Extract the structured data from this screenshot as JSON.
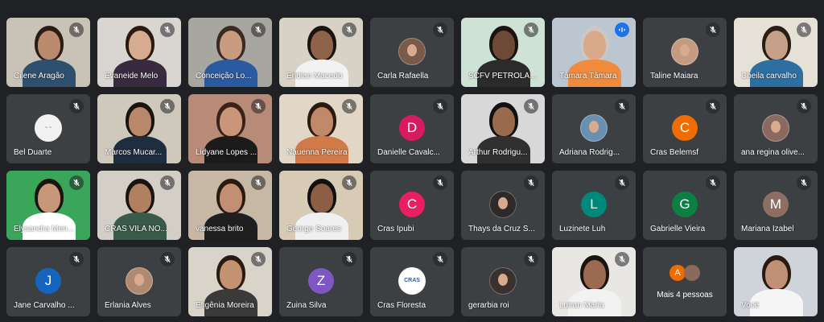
{
  "colors": {
    "background": "#202124",
    "tile": "#3c4043",
    "speaking_outline": "#8ab4f8"
  },
  "participants": [
    {
      "name": "Cilene Aragão",
      "type": "video",
      "bg": "#c9c2b6",
      "skin": "#b98a6d",
      "shirt": "#2f4f6f",
      "hair": "#2b1d16"
    },
    {
      "name": "Evaneide Melo",
      "type": "video",
      "bg": "#d9d6d1",
      "skin": "#d6ab8f",
      "shirt": "#3a2a40",
      "hair": "#2a1a12"
    },
    {
      "name": "Conceição Lo...",
      "type": "video",
      "bg": "#a8a6a0",
      "skin": "#c99b80",
      "shirt": "#2a5aa0",
      "hair": "#3a2a20"
    },
    {
      "name": "Eridian Macedo",
      "type": "video",
      "bg": "#d8d2c6",
      "skin": "#8f624a",
      "shirt": "#f2f2f2",
      "hair": "#1a1410"
    },
    {
      "name": "Carla Rafaella",
      "type": "avatar-photo",
      "color": "#7a5a48"
    },
    {
      "name": "SCFV PETROLA...",
      "type": "video",
      "bg": "#cfe2d6",
      "skin": "#6e4a36",
      "shirt": "#2b2b2b",
      "hair": "#1a1410"
    },
    {
      "name": "Tâmara Tâmara",
      "type": "video",
      "speaking": true,
      "bg": "#bcc6d0",
      "skin": "#d9a98a",
      "shirt": "#f08a3c",
      "hair": "#c8c8c8"
    },
    {
      "name": "Taline Maiara",
      "type": "avatar-photo",
      "color": "#c49a80"
    },
    {
      "name": "Cheila carvalho",
      "type": "video",
      "bg": "#e6e1d6",
      "skin": "#c7a089",
      "shirt": "#2d6fa0",
      "hair": "#2a1d14"
    },
    {
      "name": "Bel Duarte",
      "type": "avatar-logo",
      "color": "#f2f2f2"
    },
    {
      "name": "Marcos Mucar...",
      "type": "video",
      "bg": "#cfc9bd",
      "skin": "#b9886a",
      "shirt": "#1e2e40",
      "hair": "#1a1410"
    },
    {
      "name": "Lidyane Lopes ...",
      "type": "video",
      "bg": "#b88a78",
      "skin": "#c9967a",
      "shirt": "#1b1b1b",
      "hair": "#3a2218"
    },
    {
      "name": "Nauenna Pereira",
      "type": "video",
      "bg": "#e2d7c6",
      "skin": "#c08a6a",
      "shirt": "#d07a4a",
      "hair": "#2a1a10"
    },
    {
      "name": "Danielle Cavalc...",
      "type": "avatar",
      "initial": "D",
      "color": "#d81b60"
    },
    {
      "name": "Arthur Rodrigu...",
      "type": "video",
      "bg": "#d8d8d8",
      "skin": "#9a6a4e",
      "shirt": "#303030",
      "hair": "#111"
    },
    {
      "name": "Adriana Rodrig...",
      "type": "avatar-photo",
      "color": "#6a90b0"
    },
    {
      "name": "Cras Belemsf",
      "type": "avatar",
      "initial": "C",
      "color": "#ef6c00"
    },
    {
      "name": "ana regina olive...",
      "type": "avatar-photo",
      "color": "#8a6a60"
    },
    {
      "name": "Elysandra Men...",
      "type": "video",
      "bg": "#3aa65a",
      "skin": "#c7977a",
      "shirt": "#ffffff",
      "hair": "#1a1410"
    },
    {
      "name": "CRAS VILA NO...",
      "type": "video",
      "bg": "#d4cfc6",
      "skin": "#b08060",
      "shirt": "#3a5a4a",
      "hair": "#1a1410"
    },
    {
      "name": "vanessa brito",
      "type": "video",
      "bg": "#c6b8a4",
      "skin": "#c28f72",
      "shirt": "#1f1f1f",
      "hair": "#2a1a10"
    },
    {
      "name": "George Soares",
      "type": "video",
      "bg": "#d7cbb6",
      "skin": "#8d5e44",
      "shirt": "#f0f0f0",
      "hair": "#111"
    },
    {
      "name": "Cras Ipubi",
      "type": "avatar",
      "initial": "C",
      "color": "#e91e63"
    },
    {
      "name": "Thays da Cruz S...",
      "type": "avatar-photo",
      "color": "#2e2a2a"
    },
    {
      "name": "Luzinete Luh",
      "type": "avatar",
      "initial": "L",
      "color": "#00897b"
    },
    {
      "name": "Gabrielle Vieira",
      "type": "avatar",
      "initial": "G",
      "color": "#0b8043"
    },
    {
      "name": "Mariana Izabel",
      "type": "avatar",
      "initial": "M",
      "color": "#8d6e63"
    },
    {
      "name": "Jane Carvalho ...",
      "type": "avatar",
      "initial": "J",
      "color": "#1565c0"
    },
    {
      "name": "Erlania Alves",
      "type": "avatar-photo",
      "color": "#b08a70"
    },
    {
      "name": "Efigênia Moreira",
      "type": "video",
      "bg": "#d9d4ca",
      "skin": "#c29272",
      "shirt": "#3a3a3a",
      "hair": "#2a1a10"
    },
    {
      "name": "Zuina Silva",
      "type": "avatar",
      "initial": "Z",
      "color": "#7e57c2"
    },
    {
      "name": "Cras Floresta",
      "type": "avatar-cras",
      "color": "#ffffff",
      "logo_text": "CRAS"
    },
    {
      "name": "gerarbia roi",
      "type": "avatar-photo",
      "color": "#3a3030"
    },
    {
      "name": "Luiran Maria",
      "type": "video",
      "bg": "#e9e7e3",
      "skin": "#9c6a50",
      "shirt": "#f2f2f2",
      "hair": "#1a1410"
    },
    {
      "name": "Mais 4 pessoas",
      "type": "more",
      "initial": "A",
      "color": "#ef6c00"
    },
    {
      "name": "Você",
      "type": "video",
      "self": true,
      "bg": "#cfd4da",
      "skin": "#c09076",
      "shirt": "#f5f5f5",
      "hair": "#2a1a10"
    }
  ]
}
